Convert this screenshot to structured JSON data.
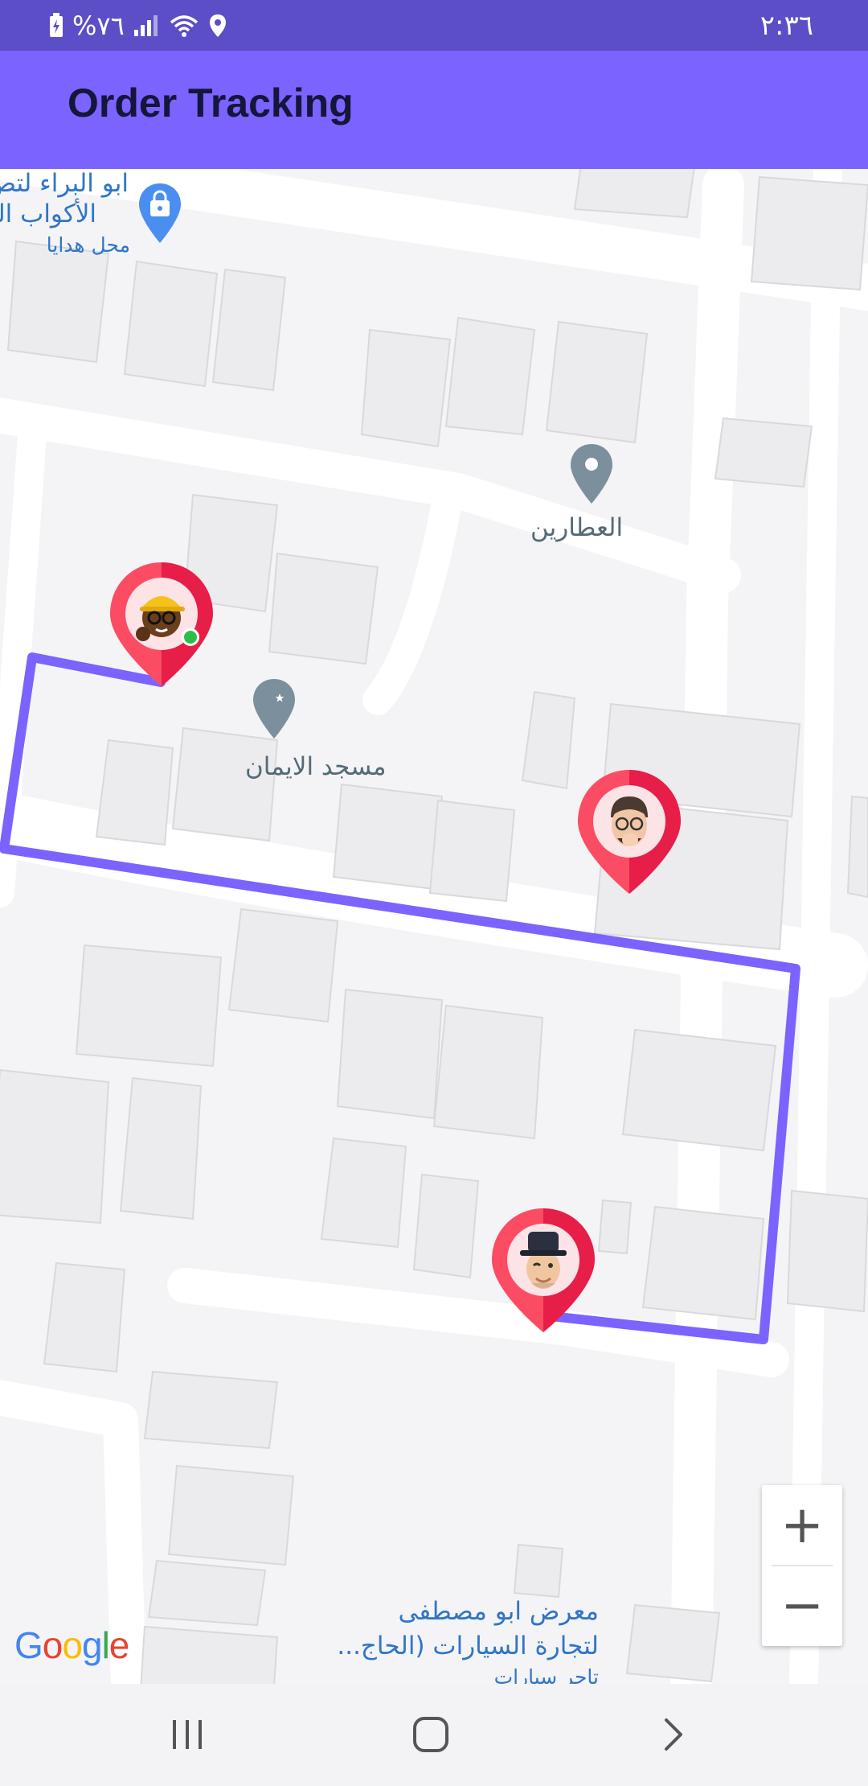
{
  "status_bar": {
    "battery": "%٧٦",
    "time": "٢:٣٦"
  },
  "app_bar": {
    "title": "Order Tracking"
  },
  "map": {
    "route_color": "#7b63ff",
    "poi": {
      "gift_shop_line1": "ابو البراء لتص",
      "gift_shop_line2": "الأكواب الورق",
      "gift_shop_category": "محل هدايا",
      "attareen": "العطارين",
      "mosque": "مسجد الايمان",
      "car_showroom_line1": "معرض ابو مصطفى",
      "car_showroom_line2": "لتجارة السيارات (الحاج...",
      "car_showroom_category": "تاجر سيارات"
    },
    "markers": [
      {
        "name": "courier-marker",
        "avatar": "courier-avatar-icon",
        "online": true
      },
      {
        "name": "waypoint-marker",
        "avatar": "customer-avatar-icon",
        "online": false
      },
      {
        "name": "destination-marker",
        "avatar": "recipient-avatar-icon",
        "online": false
      }
    ],
    "zoom_in": "+",
    "zoom_out": "−",
    "attribution": "Google"
  },
  "colors": {
    "status_bar": "#5b4ec7",
    "app_bar": "#7b63ff",
    "pin": "#f2405c",
    "title": "#14163a"
  }
}
